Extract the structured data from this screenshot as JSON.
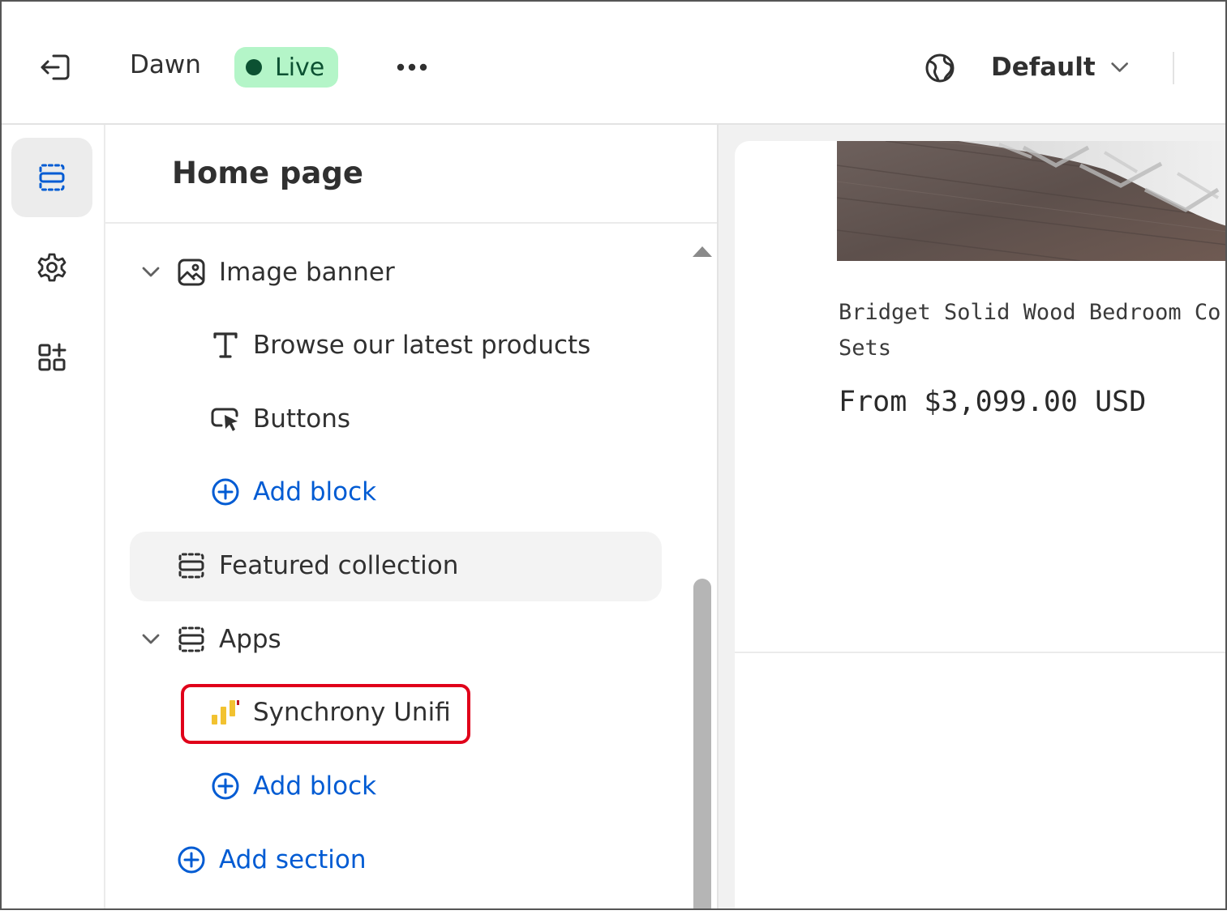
{
  "topbar": {
    "theme_name": "Dawn",
    "status_badge": "Live",
    "locale_select": "Default",
    "icons": [
      "exit-icon",
      "more-horizontal-icon",
      "globe-icon",
      "chevron-down-icon"
    ]
  },
  "rail": {
    "items": [
      {
        "name": "sections",
        "icon": "sections-icon",
        "active": true
      },
      {
        "name": "theme-settings",
        "icon": "gear-icon",
        "active": false
      },
      {
        "name": "app-embeds",
        "icon": "app-embed-icon",
        "active": false
      }
    ]
  },
  "panel": {
    "title": "Home page",
    "sections": [
      {
        "label": "Image banner",
        "icon": "image-icon",
        "expanded": true,
        "blocks": [
          {
            "label": "Browse our latest products",
            "icon": "text-icon"
          },
          {
            "label": "Buttons",
            "icon": "button-icon"
          }
        ],
        "add_block": "Add block"
      },
      {
        "label": "Featured collection",
        "icon": "section-icon",
        "expanded": false
      },
      {
        "label": "Apps",
        "icon": "section-icon",
        "expanded": true,
        "blocks": [
          {
            "label": "Synchrony Unifi",
            "icon": "synchrony-app-icon"
          }
        ],
        "add_block": "Add block"
      }
    ],
    "add_section": "Add section"
  },
  "preview": {
    "product_title": "Bridget Solid Wood Bedroom Co\nSets",
    "product_price": "From $3,099.00 USD"
  },
  "colors": {
    "live_badge_bg": "#b4f5c8",
    "live_text": "#0c5132",
    "link_blue": "#005bd3",
    "highlight_red": "#e0001a",
    "app_icon_yellow": "#f2c230"
  }
}
